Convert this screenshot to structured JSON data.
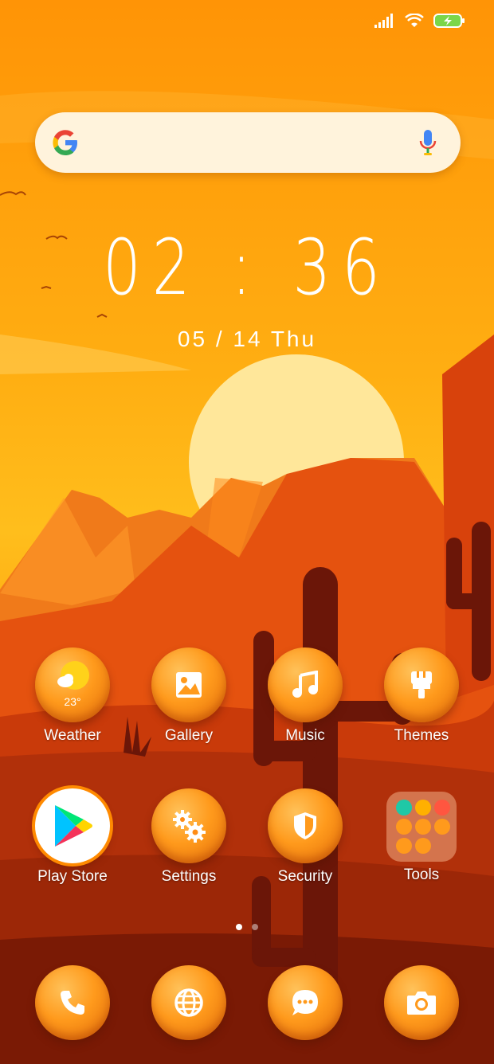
{
  "status_bar": {
    "icons": [
      "signal-icon",
      "wifi-icon",
      "battery-charging-icon"
    ]
  },
  "search": {
    "icons": [
      "google-g-icon",
      "mic-icon"
    ]
  },
  "clock": {
    "time": "02 : 36",
    "date": "05 / 14   Thu"
  },
  "apps_row1": [
    {
      "label": "Weather",
      "icon": "weather-icon",
      "temp": "23°"
    },
    {
      "label": "Gallery",
      "icon": "gallery-icon"
    },
    {
      "label": "Music",
      "icon": "music-icon"
    },
    {
      "label": "Themes",
      "icon": "themes-icon"
    }
  ],
  "apps_row2": [
    {
      "label": "Play Store",
      "icon": "play-store-icon"
    },
    {
      "label": "Settings",
      "icon": "settings-icon"
    },
    {
      "label": "Security",
      "icon": "security-icon"
    },
    {
      "label": "Tools",
      "icon": "folder-icon"
    }
  ],
  "dock": [
    {
      "icon": "phone-icon"
    },
    {
      "icon": "browser-icon"
    },
    {
      "icon": "messages-icon"
    },
    {
      "icon": "camera-icon"
    }
  ],
  "page_indicator": {
    "pages": 2,
    "current": 1
  },
  "colors": {
    "sky_top": "#ff9a0a",
    "sun": "#ffe89a",
    "mountain": "#e5480f",
    "ground_dark": "#7a1a05",
    "icon_orange": "#ff9a1c"
  }
}
